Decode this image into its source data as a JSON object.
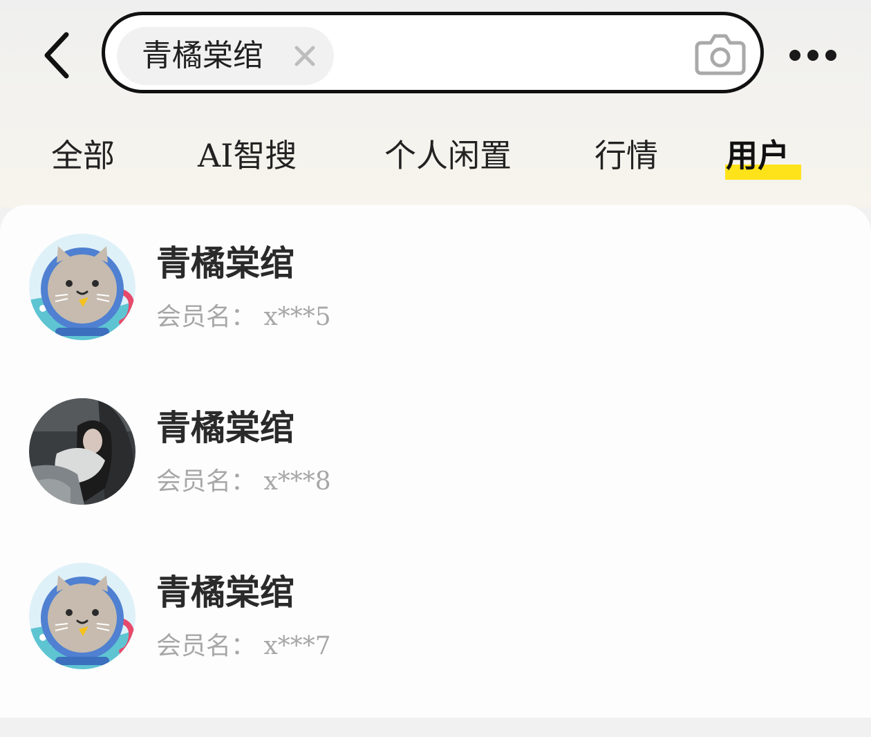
{
  "search": {
    "chip_text": "青橘棠绾"
  },
  "tabs": [
    {
      "label": "全部",
      "active": false
    },
    {
      "label": "AI智搜",
      "active": false
    },
    {
      "label": "个人闲置",
      "active": false
    },
    {
      "label": "行情",
      "active": false
    },
    {
      "label": "用户",
      "active": true
    }
  ],
  "colors": {
    "active_tab_highlight": "#ffe31a",
    "search_border": "#111111",
    "secondary_text": "#a7a7a7"
  },
  "icons": {
    "back": "back-arrow-icon",
    "clear": "close-icon",
    "camera": "camera-icon",
    "more": "more-dots-icon"
  },
  "users": [
    {
      "name": "青橘棠绾",
      "member_label": "会员名：",
      "member_id": "x***5",
      "avatar": "cartoon-seal-avatar"
    },
    {
      "name": "青橘棠绾",
      "member_label": "会员名：",
      "member_id": "x***8",
      "avatar": "photo-avatar"
    },
    {
      "name": "青橘棠绾",
      "member_label": "会员名：",
      "member_id": "x***7",
      "avatar": "cartoon-seal-avatar"
    }
  ]
}
